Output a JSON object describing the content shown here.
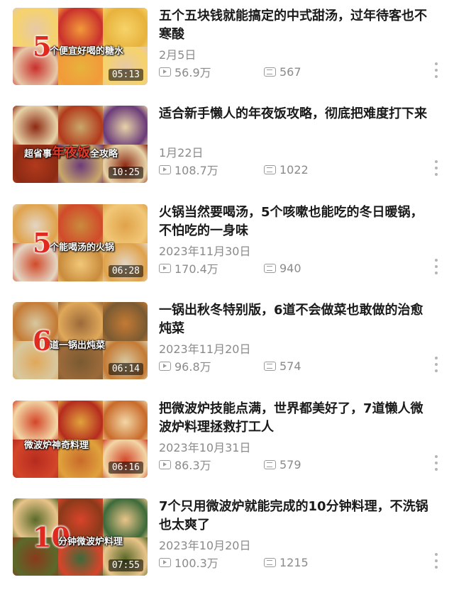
{
  "videos": [
    {
      "cover_number": "5",
      "cover_text": "个便宜好喝的糖水",
      "cover_accent": "",
      "cover_text_after": "",
      "duration": "05:13",
      "title": "五个五块钱就能搞定的中式甜汤，过年待客也不寒酸",
      "date": "2月5日",
      "plays": "56.9万",
      "comments": "567",
      "palette": [
        "#e6c9a8",
        "#f29a3a",
        "#f6d36a",
        "#c9302c",
        "#e8b23c"
      ]
    },
    {
      "cover_number": "",
      "cover_text": "超省事",
      "cover_accent": "年夜饭",
      "cover_text_after": "全攻略",
      "duration": "10:25",
      "title": "适合新手懒人的年夜饭攻略，彻底把难度打下来",
      "date": "1月22日",
      "plays": "108.7万",
      "comments": "1022",
      "palette": [
        "#8c2a14",
        "#c9a76a",
        "#e7d3a8",
        "#b23a1c",
        "#6b3b7a"
      ]
    },
    {
      "cover_number": "5",
      "cover_text": "个能喝汤的火锅",
      "cover_accent": "",
      "cover_text_after": "",
      "duration": "06:28",
      "title": "火锅当然要喝汤，5个咳嗽也能吃的冬日暖锅，不怕吃的一身味",
      "date": "2023年11月30日",
      "plays": "170.4万",
      "comments": "940",
      "palette": [
        "#e3d6c4",
        "#c98b3d",
        "#e0a24a",
        "#d14a2a",
        "#f1c878"
      ]
    },
    {
      "cover_number": "6",
      "cover_text": "道一锅出炖菜",
      "cover_accent": "",
      "cover_text_after": "",
      "duration": "06:14",
      "title": "一锅出秋冬特别版，6道不会做菜也敢做的治愈炖菜",
      "date": "2023年11月20日",
      "plays": "96.8万",
      "comments": "574",
      "palette": [
        "#d8c8a0",
        "#9c6a3a",
        "#c47a34",
        "#e0a85a",
        "#7a5a32"
      ]
    },
    {
      "cover_number": "",
      "cover_text": "微波炉神奇料理",
      "cover_accent": "",
      "cover_text_after": "",
      "duration": "06:16",
      "title": "把微波炉技能点满，世界都美好了，7道懒人微波炉料理拯救打工人",
      "date": "2023年10月31日",
      "plays": "86.3万",
      "comments": "579",
      "palette": [
        "#d4462a",
        "#e0a23c",
        "#f2d7a6",
        "#b52b1e",
        "#c96a2a"
      ]
    },
    {
      "cover_number": "10",
      "cover_text": "分钟微波炉料理",
      "cover_accent": "",
      "cover_text_after": "",
      "duration": "07:55",
      "title": "7个只用微波炉就能完成的10分钟料理，不洗锅也太爽了",
      "date": "2023年10月20日",
      "plays": "100.3万",
      "comments": "1215",
      "palette": [
        "#5a6a2a",
        "#d8442a",
        "#e9c48a",
        "#8a3a1a",
        "#3c6a3a"
      ]
    }
  ]
}
